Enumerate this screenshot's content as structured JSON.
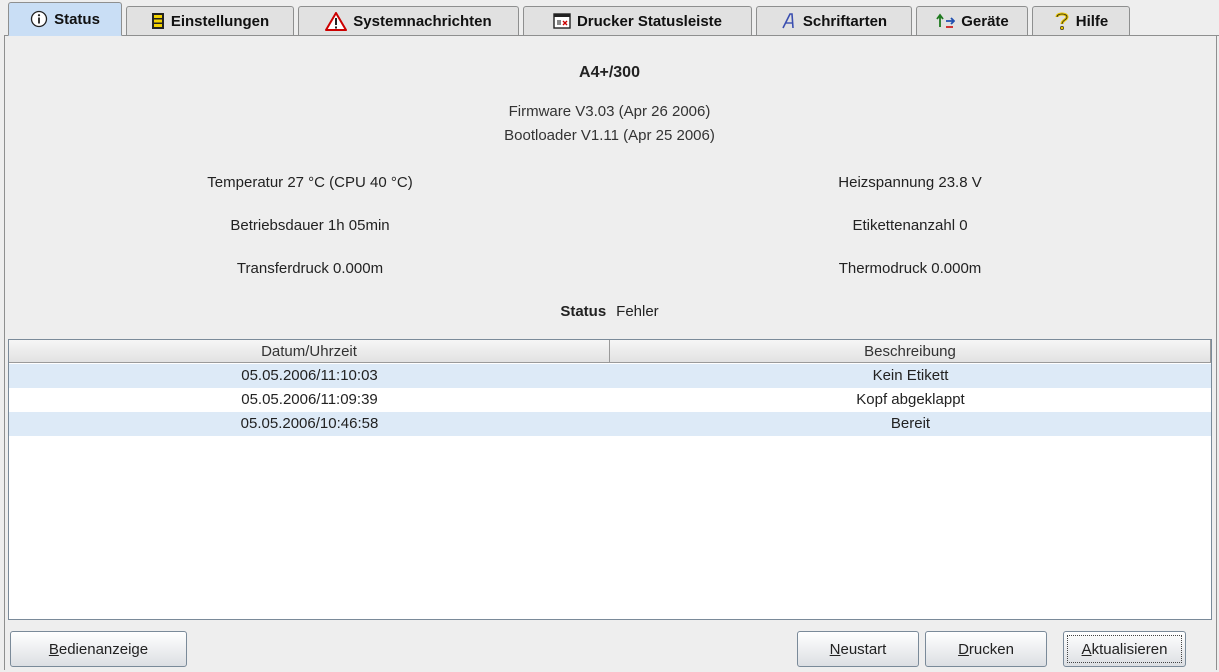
{
  "tabs": [
    {
      "label": "Status",
      "icon": "info-icon",
      "active": true
    },
    {
      "label": "Einstellungen",
      "icon": "settings-icon"
    },
    {
      "label": "Systemnachrichten",
      "icon": "warning-icon"
    },
    {
      "label": "Drucker Statusleiste",
      "icon": "printer-statusbar-icon"
    },
    {
      "label": "Schriftarten",
      "icon": "font-icon"
    },
    {
      "label": "Geräte",
      "icon": "devices-icon"
    },
    {
      "label": "Hilfe",
      "icon": "help-icon"
    }
  ],
  "printer": {
    "model": "A4+/300",
    "firmware": "Firmware V3.03 (Apr 26 2006)",
    "bootloader": "Bootloader V1.11 (Apr 25 2006)"
  },
  "stats": {
    "temperature": "Temperatur 27 °C (CPU 40 °C)",
    "heating_voltage": "Heizspannung 23.8 V",
    "operating_time": "Betriebsdauer 1h 05min",
    "label_count": "Etikettenanzahl 0",
    "transfer_print": "Transferdruck 0.000m",
    "thermo_print": "Thermodruck 0.000m"
  },
  "status": {
    "label": "Status",
    "value": "Fehler"
  },
  "table": {
    "columns": [
      "Datum/Uhrzeit",
      "Beschreibung"
    ],
    "rows": [
      {
        "datetime": "05.05.2006/11:10:03",
        "description": "Kein Etikett"
      },
      {
        "datetime": "05.05.2006/11:09:39",
        "description": "Kopf abgeklappt"
      },
      {
        "datetime": "05.05.2006/10:46:58",
        "description": "Bereit"
      }
    ]
  },
  "buttons": {
    "operator_panel": {
      "first": "B",
      "rest": "edienanzeige"
    },
    "restart": {
      "first": "N",
      "rest": "eustart"
    },
    "print": {
      "first": "D",
      "rest": "rucken"
    },
    "refresh": {
      "first": "A",
      "rest": "ktualisieren"
    }
  },
  "colors": {
    "active_tab": "#c9def5",
    "row_stripe": "#ddeaf7",
    "warning": "#cc0000",
    "help": "#e8c400"
  }
}
